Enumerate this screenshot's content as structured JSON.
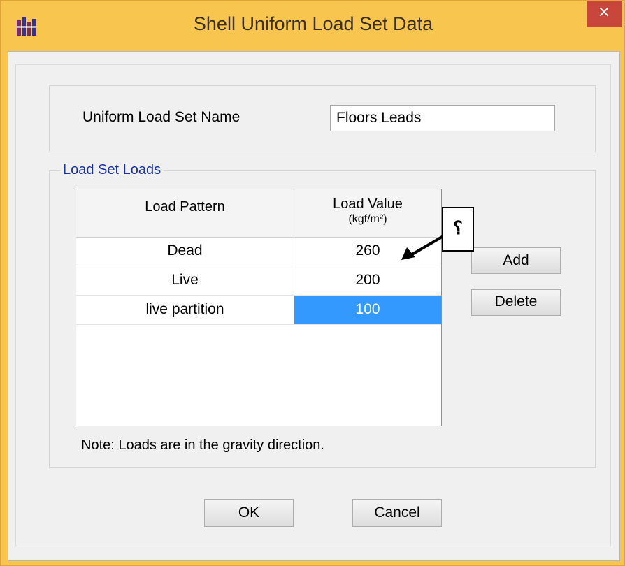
{
  "window": {
    "title": "Shell Uniform Load Set Data",
    "close_glyph": "×",
    "app_icon": "etabs-app-icon"
  },
  "name_section": {
    "label": "Uniform Load Set Name",
    "value": "Floors Leads"
  },
  "loads_section": {
    "legend": "Load Set Loads",
    "columns": {
      "pattern": "Load Pattern",
      "value": "Load Value",
      "value_unit": "(kgf/m²)"
    },
    "rows": [
      {
        "pattern": "Dead",
        "value": "260",
        "selected": false
      },
      {
        "pattern": "Live",
        "value": "200",
        "selected": false
      },
      {
        "pattern": "live partition",
        "value": "100",
        "selected": true
      }
    ],
    "add_label": "Add",
    "delete_label": "Delete",
    "note": "Note:  Loads are in the gravity direction."
  },
  "footer": {
    "ok_label": "OK",
    "cancel_label": "Cancel"
  },
  "annotation": {
    "callout_text": "؟"
  },
  "colors": {
    "title_bar": "#f8c64f",
    "close_button": "#c9463d",
    "selection": "#3399ff",
    "group_legend": "#1a32a3"
  }
}
